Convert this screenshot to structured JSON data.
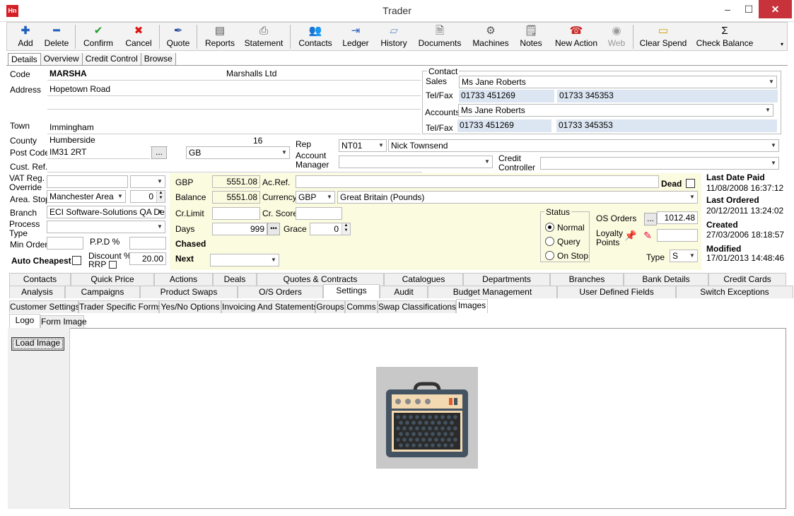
{
  "window": {
    "title": "Trader",
    "app_icon": "Hn",
    "minimize": "–",
    "maximize": "☐",
    "close": "✕"
  },
  "toolbar": {
    "add": "Add",
    "delete": "Delete",
    "confirm": "Confirm",
    "cancel": "Cancel",
    "quote": "Quote",
    "reports": "Reports",
    "statement": "Statement",
    "contacts": "Contacts",
    "ledger": "Ledger",
    "history": "History",
    "documents": "Documents",
    "machines": "Machines",
    "notes": "Notes",
    "new_action": "New Action",
    "web": "Web",
    "clear_spend": "Clear Spend",
    "check_balance": "Check Balance"
  },
  "main_tabs": [
    "Details",
    "Overview",
    "Credit Control",
    "Browse"
  ],
  "details": {
    "code_label": "Code",
    "code": "MARSHA",
    "name": "Marshalls Ltd",
    "address_label": "Address",
    "address1": "Hopetown Road",
    "address2": "",
    "address3": "",
    "town_label": "Town",
    "town": "Immingham",
    "county_label": "County",
    "county": "Humberside",
    "county_count": "16",
    "postcode_label": "Post Code",
    "postcode": "IM31 2RT",
    "postcode_btn": "...",
    "country": "GB",
    "custref_label": "Cust. Ref.",
    "custref": "",
    "vat_label1": "VAT Reg.",
    "vat_label2": "Override",
    "vat": "",
    "area_label": "Area. Stop",
    "area": "Manchester Area",
    "area_stop": "0",
    "branch_label": "Branch",
    "branch": "ECI Software-Solutions QA Dep",
    "process_label1": "Process",
    "process_label2": "Type",
    "process": "",
    "minorder_label": "Min Order",
    "minorder": "",
    "ppd_label": "P.P.D %",
    "ppd": "",
    "autocheapest_label": "Auto Cheapest",
    "discount_label1": "Discount %",
    "discount_label2": "RRP",
    "discount": "20.00"
  },
  "contact": {
    "group_label": "Contact",
    "sales_label": "Sales",
    "sales": "Ms Jane Roberts",
    "telfax_label": "Tel/Fax",
    "sales_tel": "01733 451269",
    "sales_fax": "01733 345353",
    "accounts_label": "Accounts",
    "accounts": "Ms Jane Roberts",
    "acc_tel": "01733 451269",
    "acc_fax": "01733 345353"
  },
  "rep": {
    "rep_label": "Rep",
    "rep_code": "NT01",
    "rep_name": "Nick Townsend",
    "accmgr_label1": "Account",
    "accmgr_label2": "Manager",
    "accmgr": "",
    "credctrl_label1": "Credit",
    "credctrl_label2": "Controller",
    "credctrl": ""
  },
  "account": {
    "gbp_label": "GBP",
    "gbp": "5551.08",
    "balance_label": "Balance",
    "balance": "5551.08",
    "crlimit_label": "Cr.Limit",
    "crlimit": "",
    "days_label": "Days",
    "days": "999",
    "days_btn": "•••",
    "grace_label": "Grace",
    "grace": "0",
    "chased_label": "Chased",
    "next_label": "Next",
    "next": "",
    "acref_label": "Ac.Ref.",
    "acref": "",
    "dead_label": "Dead",
    "currency_label": "Currency",
    "currency_code": "GBP",
    "currency_name": "Great Britain (Pounds)",
    "crscore_label": "Cr. Score",
    "crscore": ""
  },
  "status": {
    "group_label": "Status",
    "options": [
      "Normal",
      "Query",
      "On Stop"
    ],
    "selected": "Normal"
  },
  "os": {
    "osorders_label": "OS Orders",
    "osorders_btn": "...",
    "osorders": "1012.48",
    "loyalty_label1": "Loyalty",
    "loyalty_label2": "Points",
    "loyalty": "",
    "type_label": "Type",
    "type": "S"
  },
  "dates": {
    "lastpaid_label": "Last Date Paid",
    "lastpaid": "11/08/2008 16:37:12",
    "lastordered_label": "Last Ordered",
    "lastordered": "20/12/2011 13:24:02",
    "created_label": "Created",
    "created": "27/03/2006 18:18:57",
    "modified_label": "Modified",
    "modified": "17/01/2013 14:48:46"
  },
  "tabs_row1": [
    "Contacts",
    "Quick Price",
    "Actions",
    "Deals",
    "Quotes & Contracts",
    "Catalogues",
    "Departments",
    "Branches",
    "Bank Details",
    "Credit Cards"
  ],
  "tabs_row2": [
    "Analysis",
    "Campaigns",
    "Product Swaps",
    "O/S Orders",
    "Settings",
    "Audit",
    "Budget Management",
    "User Defined Fields",
    "Switch Exceptions"
  ],
  "settings_tabs": [
    "Customer Settings",
    "Trader Specific Forms",
    "Yes/No Options",
    "Invoicing And Statements",
    "Groups",
    "Comms",
    "Swap Classifications",
    "Images"
  ],
  "image_tabs": [
    "Logo",
    "Form Image"
  ],
  "load_image": "Load Image",
  "colors": {
    "accent": "#d51f26",
    "yellow": "#fbfbe0",
    "blue_field": "#dce6f2"
  }
}
